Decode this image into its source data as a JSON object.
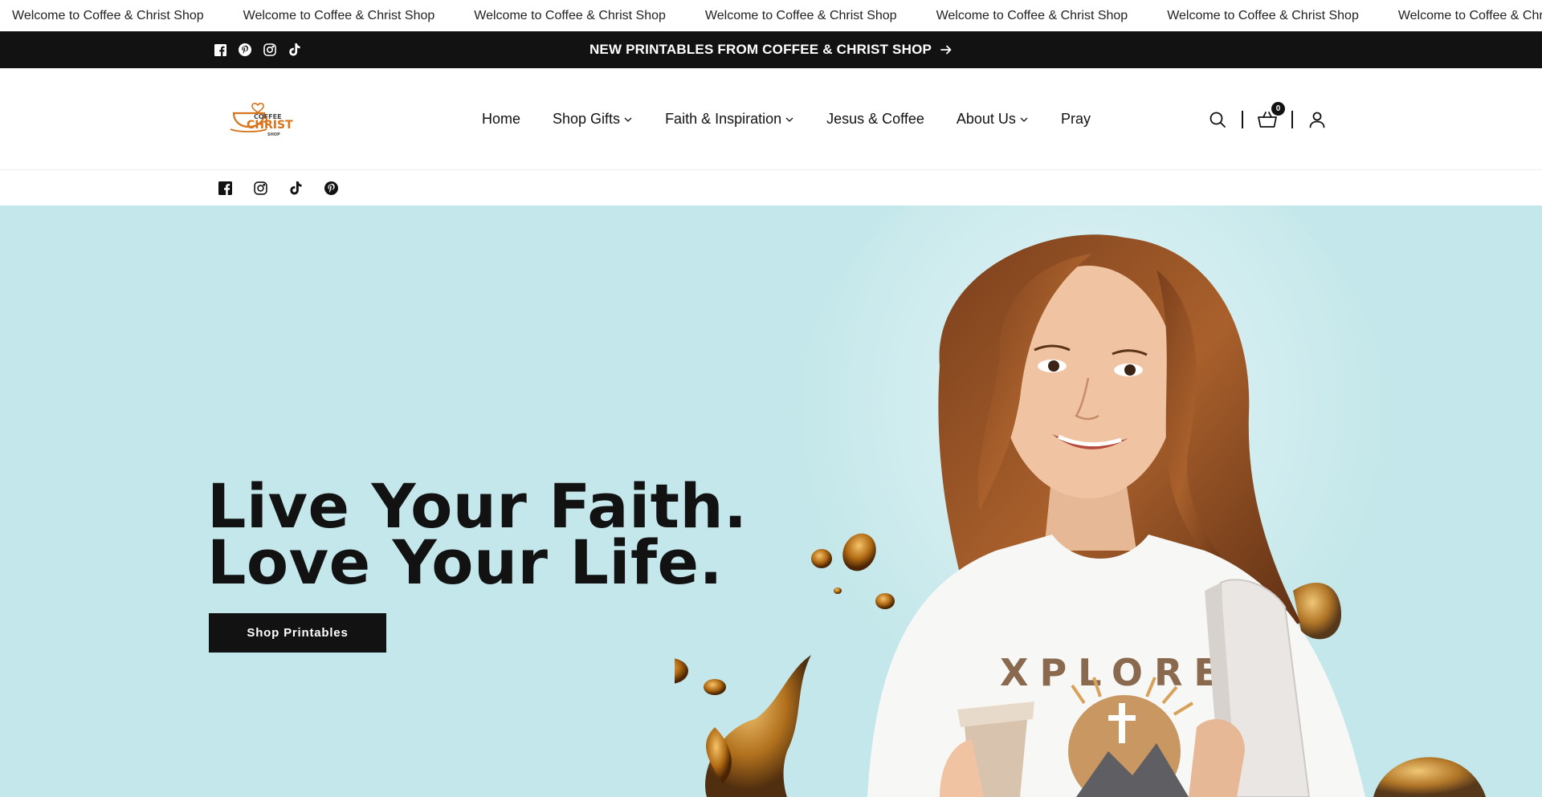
{
  "marquee": {
    "items": [
      "Welcome to Coffee & Christ Shop",
      "Welcome to Coffee & Christ Shop",
      "Welcome to Coffee & Christ Shop",
      "Welcome to Coffee & Christ Shop",
      "Welcome to Coffee & Christ Shop",
      "Welcome to Coffee & Christ Shop",
      "Welcome to Coffee & Christ Shop"
    ]
  },
  "announcement": {
    "text": "NEW PRINTABLES FROM COFFEE & CHRIST SHOP",
    "social_icons": [
      "facebook-icon",
      "pinterest-icon",
      "instagram-icon",
      "tiktok-icon"
    ]
  },
  "header": {
    "logo": {
      "line1": "COFFEE",
      "line2": "CHRIST",
      "line3": "SHOP"
    },
    "nav": [
      {
        "label": "Home",
        "has_dropdown": false
      },
      {
        "label": "Shop Gifts",
        "has_dropdown": true
      },
      {
        "label": "Faith & Inspiration",
        "has_dropdown": true
      },
      {
        "label": "Jesus & Coffee",
        "has_dropdown": false
      },
      {
        "label": "About Us",
        "has_dropdown": true
      },
      {
        "label": "Pray",
        "has_dropdown": false
      }
    ],
    "cart_count": "0"
  },
  "social_row": {
    "icons": [
      "facebook-icon",
      "instagram-icon",
      "tiktok-icon",
      "pinterest-icon"
    ]
  },
  "hero": {
    "title_line1": "Live Your Faith.",
    "title_line2": "Love Your Life.",
    "button_label": "Shop Printables",
    "shirt_text": "XPLORE"
  },
  "colors": {
    "hero_bg": "#c3e7ea",
    "dark": "#121212",
    "logo_orange": "#d9731a"
  }
}
